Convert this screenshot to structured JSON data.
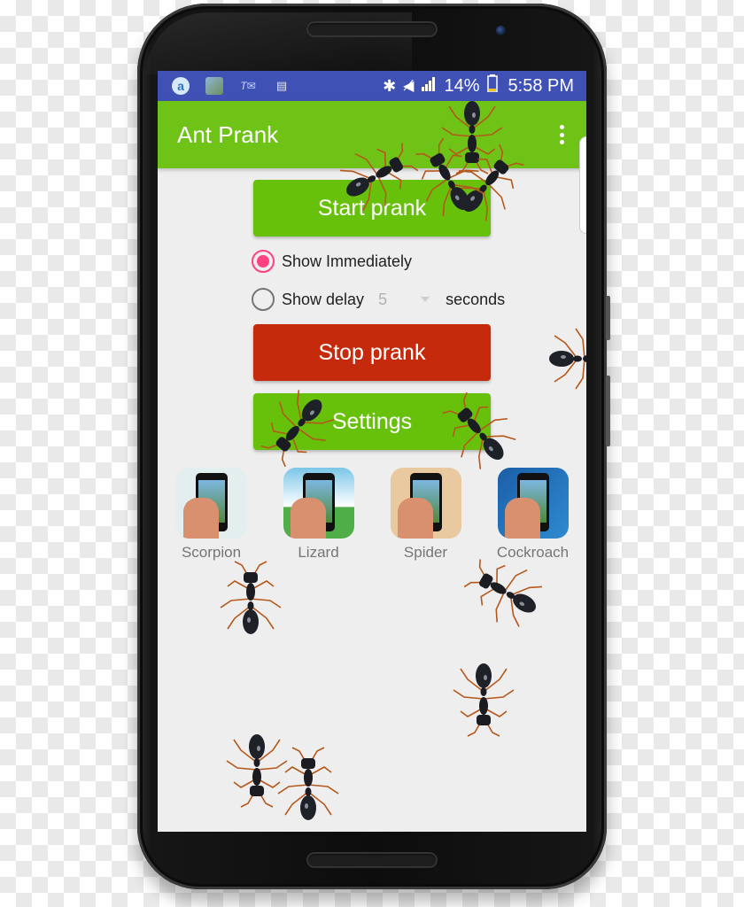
{
  "status_bar": {
    "notification_icons": [
      "app-a-icon",
      "gallery-app-icon",
      "tts-icon",
      "no-sim-icon"
    ],
    "system_icons": [
      "bluetooth-icon",
      "mute-icon",
      "signal-icon"
    ],
    "battery_percent": "14%",
    "time": "5:58 PM"
  },
  "app_bar": {
    "title": "Ant Prank",
    "menu_icon": "overflow-menu-icon"
  },
  "main": {
    "start_button": "Start prank",
    "options": [
      {
        "label": "Show Immediately",
        "checked": true
      },
      {
        "label": "Show delay",
        "checked": false
      }
    ],
    "delay_value": "5",
    "delay_unit": "seconds",
    "stop_button": "Stop prank",
    "settings_button": "Settings"
  },
  "more_apps": [
    {
      "label": "Scorpion",
      "bg": "#e3eeee"
    },
    {
      "label": "Lizard",
      "bg": "#4fae48"
    },
    {
      "label": "Spider",
      "bg": "#e8c9a0"
    },
    {
      "label": "Cockroach",
      "bg": "#1f6fb8"
    }
  ],
  "colors": {
    "status_bar": "#3f51b5",
    "app_bar": "#6ec316",
    "primary_button": "#67c10a",
    "stop_button": "#c62a0c",
    "radio_accent": "#ff4081",
    "screen_bg": "#eeeeee"
  }
}
